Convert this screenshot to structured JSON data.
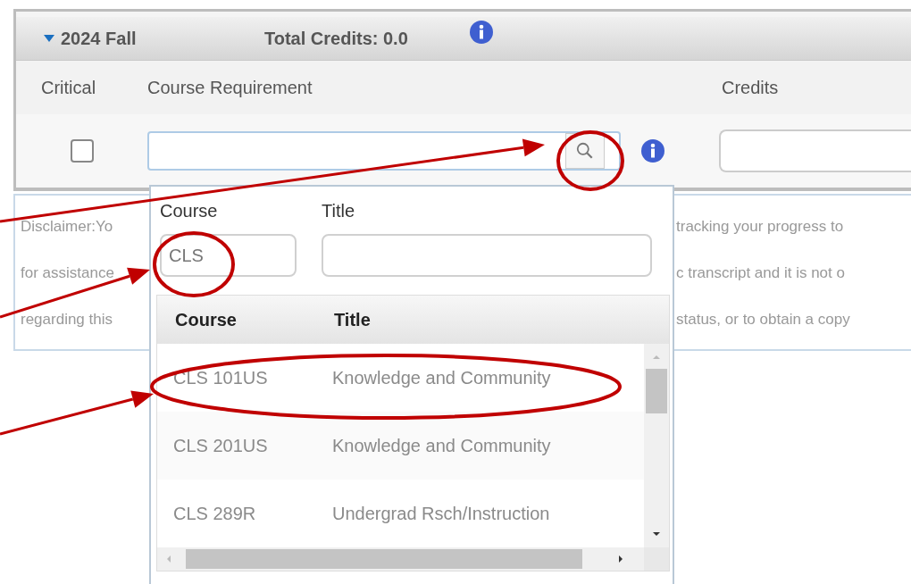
{
  "term": {
    "name": "2024 Fall",
    "expanded": true,
    "total_credits": "Total Credits: 0.0"
  },
  "columns": [
    "Critical",
    "Course Requirement",
    "Credits"
  ],
  "row": {
    "critical": false
  },
  "disclaimer": [
    {
      "left": "Disclaimer:Yo",
      "right": "tracking your progress to"
    },
    {
      "left": "for assistance",
      "right": "c transcript and it is not o"
    },
    {
      "left": "regarding this",
      "right": "status, or to obtain a copy"
    }
  ],
  "lookup": {
    "filters": [
      {
        "label": "Course",
        "value": "CLS"
      },
      {
        "label": "Title"
      }
    ],
    "columns": [
      "Course",
      "Title"
    ],
    "results": [
      {
        "course": "CLS 101US",
        "title": "Knowledge and Community"
      },
      {
        "course": "CLS 201US",
        "title": "Knowledge and Community"
      },
      {
        "course": "CLS 289R",
        "title": "Undergrad Rsch/Instruction"
      }
    ]
  }
}
